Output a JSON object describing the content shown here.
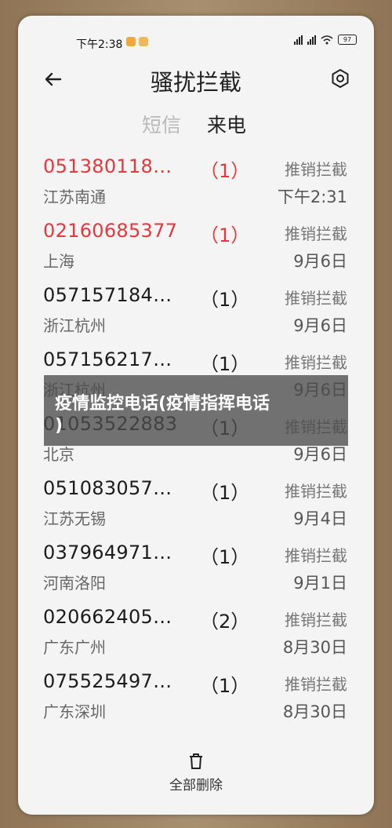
{
  "status": {
    "time": "下午2:38",
    "battery": "97"
  },
  "header": {
    "title": "骚扰拦截"
  },
  "tabs": [
    {
      "label": "短信"
    },
    {
      "label": "来电"
    }
  ],
  "calls": [
    {
      "number": "051380118…",
      "count": "（1）",
      "location": "江苏南通",
      "tag": "推销拦截",
      "time": "下午2:31",
      "highlight": true
    },
    {
      "number": "02160685377",
      "count": "（1）",
      "location": "上海",
      "tag": "推销拦截",
      "time": "9月6日",
      "highlight": true
    },
    {
      "number": "057157184…",
      "count": "（1）",
      "location": "浙江杭州",
      "tag": "推销拦截",
      "time": "9月6日",
      "highlight": false
    },
    {
      "number": "057156217…",
      "count": "（1）",
      "location": "浙江杭州",
      "tag": "推销拦截",
      "time": "9月6日",
      "highlight": false
    },
    {
      "number": "01053522883",
      "count": "（1）",
      "location": "北京",
      "tag": "推销拦截",
      "time": "9月6日",
      "highlight": false
    },
    {
      "number": "051083057…",
      "count": "（1）",
      "location": "江苏无锡",
      "tag": "推销拦截",
      "time": "9月4日",
      "highlight": false
    },
    {
      "number": "037964971…",
      "count": "（1）",
      "location": "河南洛阳",
      "tag": "推销拦截",
      "time": "9月1日",
      "highlight": false
    },
    {
      "number": "020662405…",
      "count": "（2）",
      "location": "广东广州",
      "tag": "推销拦截",
      "time": "8月30日",
      "highlight": false
    },
    {
      "number": "075525497…",
      "count": "（1）",
      "location": "广东深圳",
      "tag": "推销拦截",
      "time": "8月30日",
      "highlight": false
    }
  ],
  "footer": {
    "delete_all": "全部删除"
  },
  "watermark": {
    "line1": "疫情监控电话(疫情指挥电话",
    "line2": ")"
  },
  "colors": {
    "highlight": "#e5383b",
    "background": "#f4f4f4"
  }
}
